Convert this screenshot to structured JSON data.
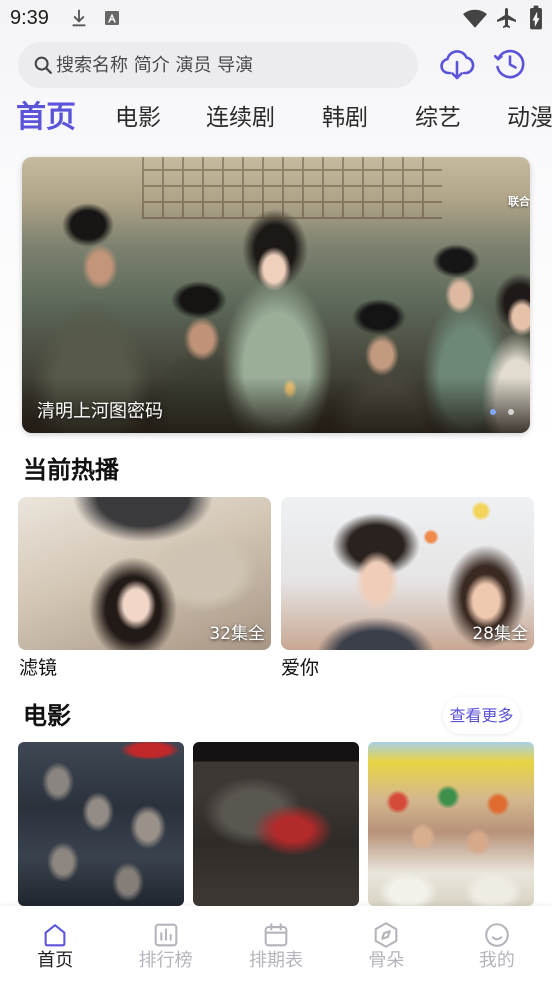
{
  "status_bar": {
    "time": "9:39",
    "notification_icons": [
      "download-icon",
      "app-notification-icon"
    ],
    "system_icons": [
      "wifi-icon",
      "airplane-mode-icon",
      "battery-charging-icon"
    ]
  },
  "search": {
    "icon": "search-icon",
    "placeholder": "搜索名称 简介 演员 导演"
  },
  "header_actions": {
    "download_icon": "cloud-download-icon",
    "history_icon": "history-clock-icon"
  },
  "tabs": [
    {
      "label": "首页",
      "active": true
    },
    {
      "label": "电影",
      "active": false
    },
    {
      "label": "连续剧",
      "active": false
    },
    {
      "label": "韩剧",
      "active": false
    },
    {
      "label": "综艺",
      "active": false
    },
    {
      "label": "动漫",
      "active": false
    }
  ],
  "banner": {
    "caption": "清明上河图密码",
    "corner_text": "联合"
  },
  "hot_section": {
    "title": "当前热播",
    "items": [
      {
        "title": "滤镜",
        "badge": "32集全"
      },
      {
        "title": "爱你",
        "badge": "28集全"
      }
    ]
  },
  "movie_section": {
    "title": "电影",
    "more_label": "查看更多"
  },
  "bottom_nav": [
    {
      "label": "首页",
      "icon": "home-icon",
      "active": true
    },
    {
      "label": "排行榜",
      "icon": "ranking-chart-icon",
      "active": false
    },
    {
      "label": "排期表",
      "icon": "calendar-icon",
      "active": false
    },
    {
      "label": "骨朵",
      "icon": "compass-icon",
      "active": false
    },
    {
      "label": "我的",
      "icon": "profile-smile-icon",
      "active": false
    }
  ],
  "colors": {
    "accent": "#5b53d9",
    "nav_inactive": "#b4b4bc",
    "heading": "#111111",
    "search_bg": "#ececf0"
  }
}
